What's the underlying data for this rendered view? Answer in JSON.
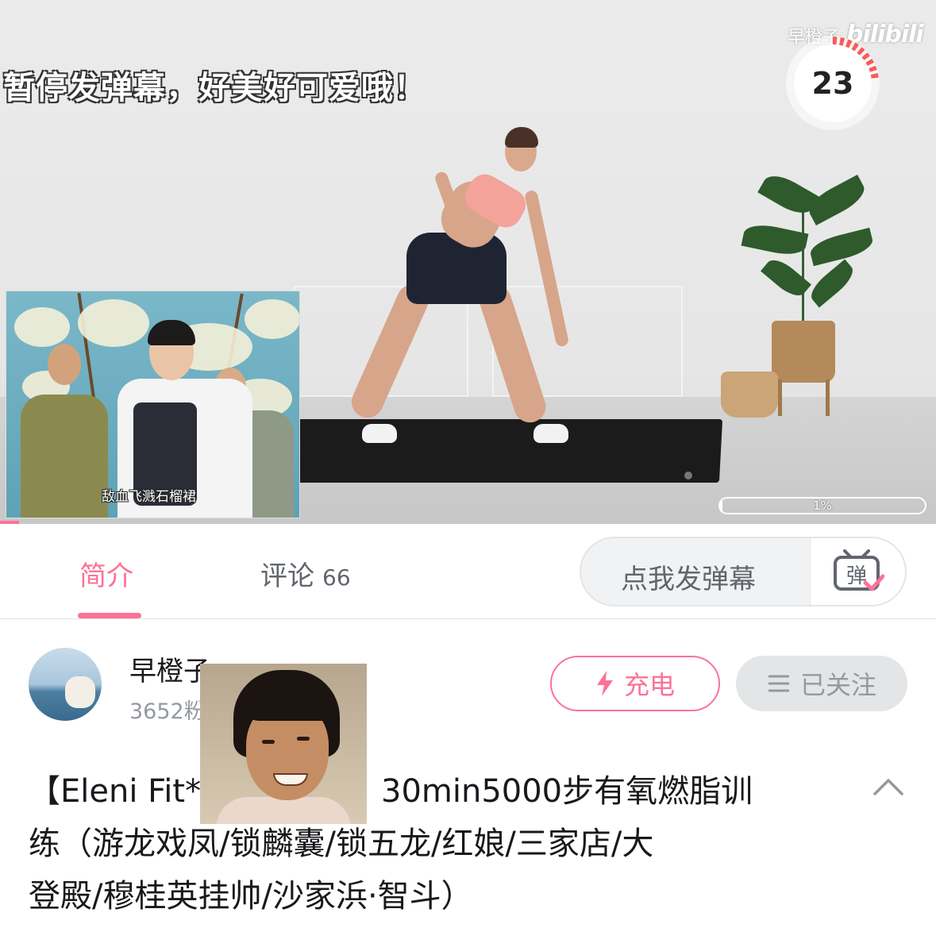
{
  "video": {
    "danmaku": "暂停发弹幕，好美好可爱哦！",
    "watermark_channel": "早橙子",
    "watermark_logo": "bilibili",
    "countdown": "23",
    "progress_label": "1%",
    "progress_fraction": 0.01,
    "inset_caption": "敌血飞溅石榴裙"
  },
  "tabs": {
    "intro_label": "简介",
    "comments_label": "评论",
    "comments_count": "66",
    "danmaku_placeholder": "点我发弹幕",
    "danmaku_icon_char": "弹"
  },
  "uploader": {
    "name": "早橙子",
    "fans": "3652粉",
    "charge_label": "充电",
    "follow_label": "已关注"
  },
  "title": {
    "part1": "【Eleni Fit*",
    "part2": "30min5000步有氧燃脂训",
    "line2": "练（游龙戏凤/锁麟囊/锁五龙/红娘/三家店/大",
    "line3": "登殿/穆桂英挂帅/沙家浜·智斗）"
  },
  "colors": {
    "accent_pink": "#fb7299",
    "text_primary": "#18191c",
    "text_secondary": "#61666d",
    "text_muted": "#9499a0",
    "button_gray": "#e3e5e7"
  }
}
